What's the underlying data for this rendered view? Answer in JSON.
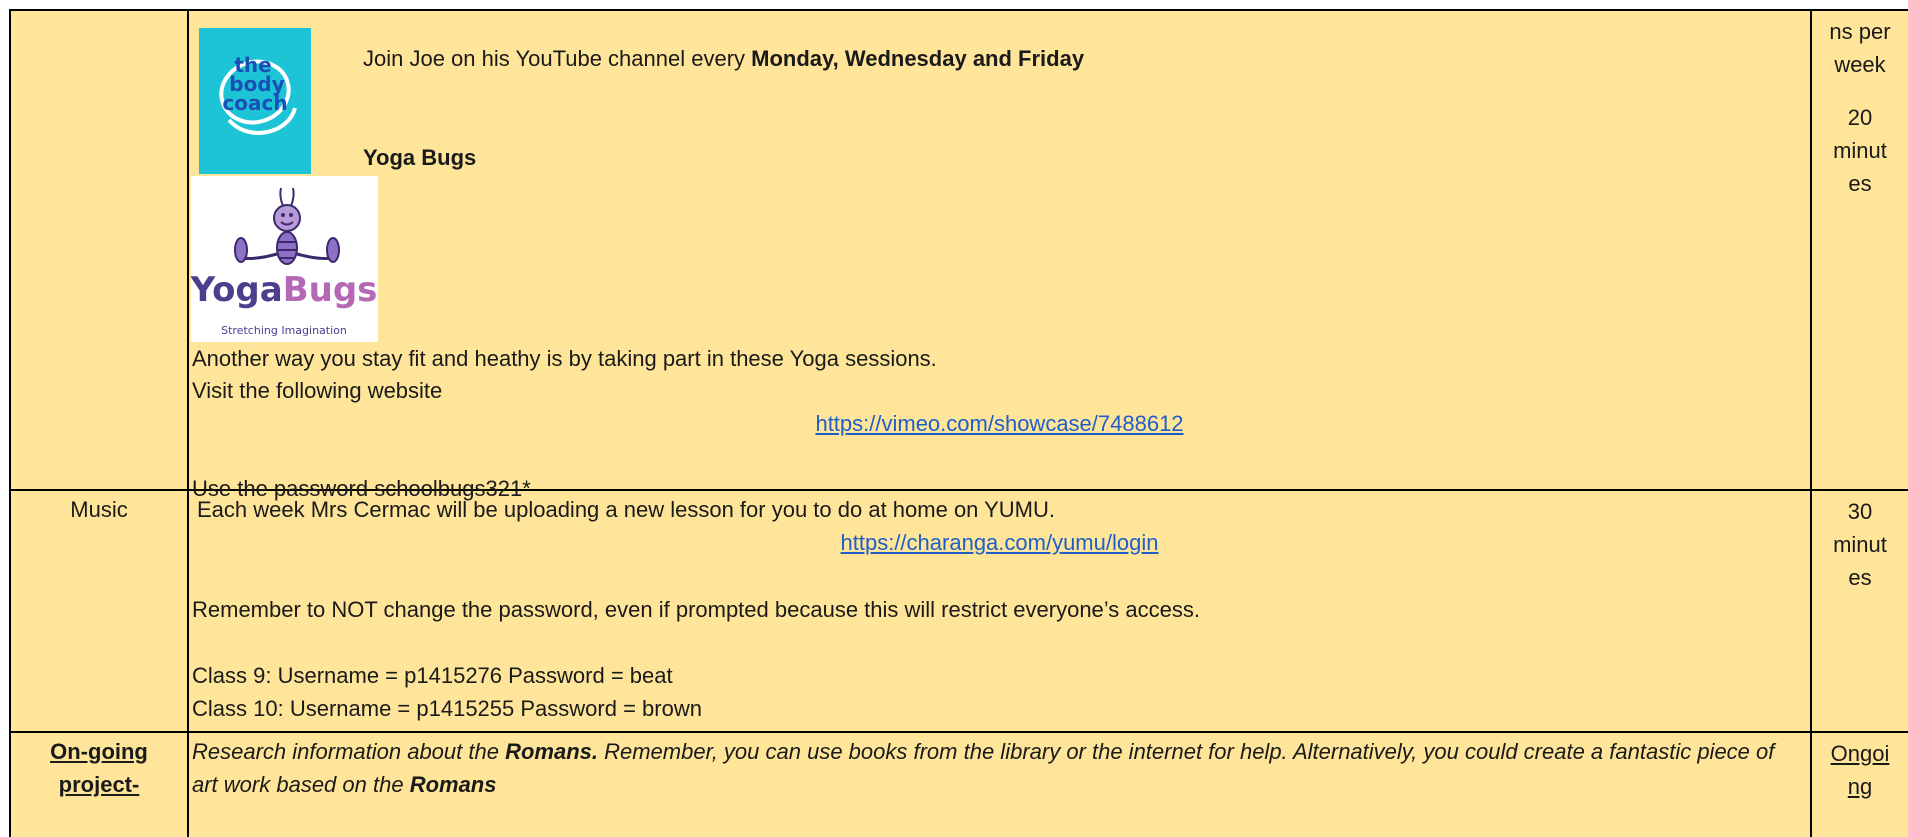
{
  "row_pe": {
    "minutes_top": [
      "ns per",
      "week"
    ],
    "minutes_bottom": [
      "20",
      "minut",
      "es"
    ],
    "bodycoach_logo_text": "the body coach",
    "bodycoach_line_prefix": "Join Joe on his YouTube channel every ",
    "bodycoach_line_days": "Monday, Wednesday and Friday",
    "yoga_heading": "Yoga Bugs",
    "yogabugs_logo_text": "YogaBugs",
    "yogabugs_logo_tagline": "Stretching Imagination",
    "yoga_para1": "Another way you stay fit and heathy is by taking part in these Yoga sessions.",
    "yoga_para2": "Visit the following website",
    "yoga_link": "https://vimeo.com/showcase/7488612",
    "yoga_password": "Use the password schoolbugs321*"
  },
  "row_music": {
    "subject": "Music",
    "minutes": [
      "30",
      "minut",
      "es"
    ],
    "intro": "Each week Mrs Cermac will be uploading a new lesson for you to do at home on YUMU.",
    "link": "https://charanga.com/yumu/login",
    "warning": "Remember to NOT change the password, even if prompted because this will restrict everyone’s access.",
    "class9": "Class 9: Username = p1415276 Password = beat",
    "class10": "Class 10: Username = p1415255 Password = brown"
  },
  "row_project": {
    "subject_line1": "On-going",
    "subject_line2": "project-",
    "minutes_line1": "Ongoi",
    "minutes_line2": "ng",
    "text_a": "Research information about the ",
    "text_b": "Romans.",
    "text_c": " Remember, you can use books from the library or the internet for help. Alternatively, you could create a fantastic piece of art work based on the ",
    "text_d": "Romans"
  },
  "colors": {
    "cell_background": "#ffe599",
    "border": "#000000",
    "link": "#1f5fc7",
    "bodycoach_bg": "#1cc4d6",
    "bodycoach_text": "#1a4fb5"
  }
}
